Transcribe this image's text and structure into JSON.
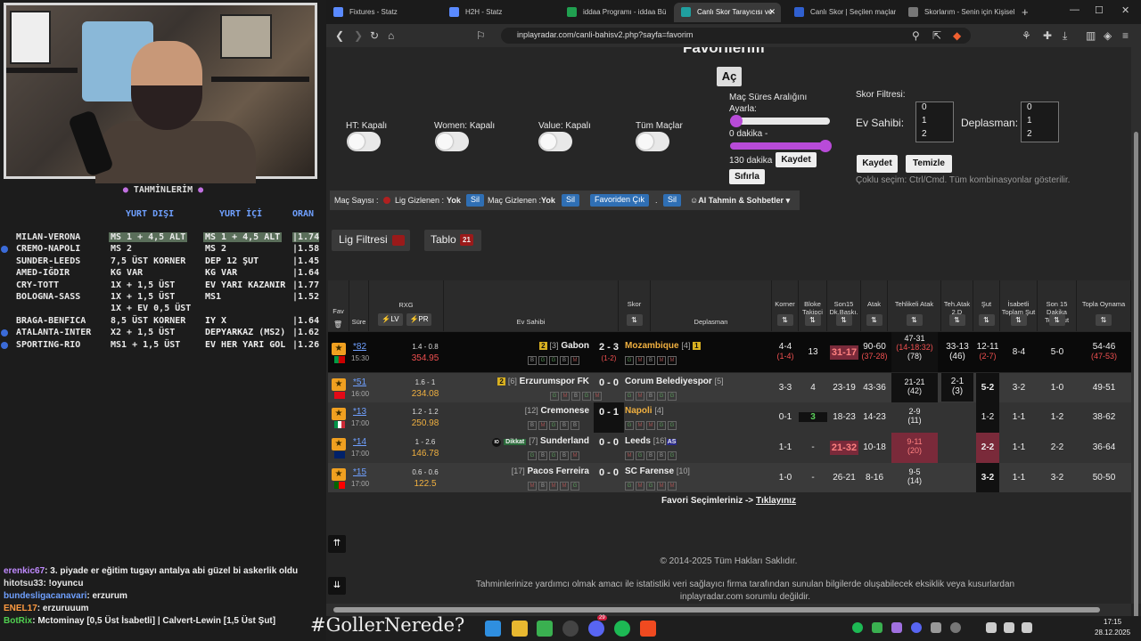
{
  "stream": {
    "title": "TAHMİNLERİM",
    "col_yurt_disi": "YURT DIŞI",
    "col_yurt_ici": "YURT İÇİ",
    "col_oran": "ORAN",
    "picks": [
      {
        "match": "MILAN-VERONA",
        "a": "MS 1 + 4,5 ALT",
        "b": "MS 1 + 4,5 ALT",
        "odd": "|1.74",
        "hl": true,
        "dot": false
      },
      {
        "match": "CREMO-NAPOLI",
        "a": "MS 2",
        "b": "MS 2",
        "odd": "|1.58",
        "hl": false,
        "dot": true
      },
      {
        "match": "SUNDER-LEEDS",
        "a": "7,5 ÜST KORNER",
        "b": "DEP 12 ŞUT",
        "odd": "|1.45",
        "hl": false,
        "dot": false
      },
      {
        "match": "AMED-IĞDIR",
        "a": "KG VAR",
        "b": "KG VAR",
        "odd": "|1.64",
        "hl": false,
        "dot": false
      },
      {
        "match": "CRY-TOTT",
        "a": "1X + 1,5 ÜST",
        "b": "EV YARI KAZANIR",
        "odd": "|1.77",
        "hl": false,
        "dot": false
      },
      {
        "match": "BOLOGNA-SASS",
        "a": "1X + 1,5 ÜST",
        "b": "MS1",
        "odd": "|1.52",
        "hl": false,
        "dot": false
      },
      {
        "match": "",
        "a": "1X + EV 0,5 ÜST",
        "b": "",
        "odd": "",
        "hl": false,
        "dot": false
      },
      {
        "match": "BRAGA-BENFICA",
        "a": "8,5 ÜST KORNER",
        "b": "IY X",
        "odd": "|1.64",
        "hl": false,
        "dot": false
      },
      {
        "match": "ATALANTA-INTER",
        "a": "X2 + 1,5 ÜST",
        "b": "DEPYARKAZ (MS2)",
        "odd": "|1.62",
        "hl": false,
        "dot": true
      },
      {
        "match": "SPORTING-RIO",
        "a": "MS1 + 1,5 ÜST",
        "b": "EV HER YARI GOL",
        "odd": "|1.26",
        "hl": false,
        "dot": true
      }
    ],
    "chat": [
      {
        "user": "erenkic67",
        "msg": ": 3. piyade er eğitim tugayı antalya abi güzel bi askerlik oldu",
        "color": "#c08aff"
      },
      {
        "user": "hitotsu33",
        "msg": ": !oyuncu",
        "color": "#ddd"
      },
      {
        "user": "bundesligacanavari",
        "msg": ": erzurum",
        "color": "#6fa0ff"
      },
      {
        "user": "ENEL17",
        "msg": ": erzuruuum",
        "color": "#ff9a40"
      },
      {
        "user": "BotRix",
        "msg": ": Mctominay [0,5 Üst İsabetli] | Calvert-Lewin [1,5 Üst Şut]",
        "color": "#50d050"
      }
    ]
  },
  "browser": {
    "tabs": [
      {
        "label": "Fixtures - Statz",
        "color": "#5a8aff",
        "active": false
      },
      {
        "label": "H2H - Statz",
        "color": "#5a8aff",
        "active": false
      },
      {
        "label": "iddaa Programı - iddaa Bü",
        "color": "#20a050",
        "active": false
      },
      {
        "label": "Canlı Skor Tarayıcısı ve",
        "color": "#20a0a0",
        "active": true
      },
      {
        "label": "Canlı Skor | Seçilen maçlar",
        "color": "#3060d0",
        "active": false
      },
      {
        "label": "Skorlarım - Senin için Kişisel",
        "color": "#777",
        "active": false
      }
    ],
    "url": "inplayradar.com/canli-bahisv2.php?sayfa=favorim"
  },
  "page": {
    "heading": "Favorilerim",
    "ac_button": "Aç",
    "ht": "HT: Kapalı",
    "women": "Women: Kapalı",
    "value": "Value: Kapalı",
    "tum": "Tüm Maçlar",
    "range_title": "Maç Süres Aralığını Ayarla:",
    "range_min": "0 dakika -",
    "range_max": "130 dakika",
    "kaydet": "Kaydet",
    "sifirla": "Sıfırla",
    "skor_filtresi": "Skor Filtresi:",
    "ev_sahibi": "Ev Sahibi:",
    "deplasman": "Deplasman:",
    "opts": [
      "0",
      "1",
      "2"
    ],
    "kaydet2": "Kaydet",
    "temizle": "Temizle",
    "coklu": "Çoklu seçim: Ctrl/Cmd. Tüm kombinasyonlar gösterilir.",
    "filterbar": {
      "mac_sayisi": "Maç Sayısı :",
      "lig_gizlenen": "Lig Gizlenen :",
      "yok1": "Yok",
      "sil1": "Sil",
      "mac_gizlenen": "Maç Gizlenen :",
      "yok2": "Yok",
      "sil2": "Sil",
      "favoriden": "Favoriden Çık",
      "dot": ".",
      "sil3": "Sil",
      "ai": "AI Tahmin & Sohbetler"
    },
    "lig_filtresi": "Lig Filtresi",
    "tablo": "Tablo",
    "tablo_count": "21",
    "footer_fav": "Favori Seçimleriniz ->",
    "footer_link": "Tıklayınız",
    "copyright": "© 2014-2025 Tüm Hakları Saklıdır.",
    "disclaimer": "Tahminlerinize yardımcı olmak amacı ile istatistiki veri sağlayıcı firma tarafından sunulan bilgilerde oluşabilecek eksiklik veya kusurlardan inplayradar.com sorumlu değildir."
  },
  "table": {
    "headers": {
      "fav": "Fav",
      "sure": "Süre",
      "rxg": "RXG",
      "lv": "LV",
      "pr": "PR",
      "ev": "Ev Sahibi",
      "skor": "Skor",
      "dep": "Deplasman",
      "korner": "Korner",
      "bloke": "Bloke Takipçi",
      "son15": "Son15 Dk.Baskı.",
      "atak": "Atak",
      "tehlikeli": "Tehlikeli Atak",
      "teh2d": "Teh.Atak 2.D",
      "sut": "Şut",
      "isabetli": "İsabetli Toplam Şut",
      "son15sut": "Son 15 Dakika Topl.Şut",
      "topla": "Topla Oynama"
    },
    "rows": [
      {
        "min": "*82",
        "kick": "15:30",
        "rxg": "1.4 - 0.8",
        "rval": "354.95",
        "home_badge": "2",
        "home_rank": "[3]",
        "home": "Gabon",
        "score": "2 - 3",
        "ht": "(1-2)",
        "away": "Mozambique",
        "away_rank": "[4]",
        "away_badge": "1",
        "hform": [
          "B",
          "G",
          "G",
          "B",
          "M"
        ],
        "aform": [
          "G",
          "M",
          "B",
          "M",
          "M"
        ],
        "korner": "4-4",
        "korner2": "(1-4)",
        "bloke": "13",
        "son15": "31-17",
        "atak": "90-60",
        "atak2": "(37-28)",
        "teh": "47-31",
        "teh2": "(14-18:32)",
        "teh3": "(78)",
        "teh2d": "33-13",
        "teh2d2": "(46)",
        "sut": "12-11",
        "sut2": "(2-7)",
        "isab": "8-4",
        "s15": "5-0",
        "topla": "54-46",
        "topla2": "(47-53)"
      },
      {
        "min": "*51",
        "kick": "16:00",
        "rxg": "1.6 - 1",
        "rval": "234.08",
        "home_badge": "2",
        "home_rank": "[6]",
        "home": "Erzurumspor FK",
        "score": "0 - 0",
        "ht": "",
        "away": "Corum Belediyespor",
        "away_rank": "[5]",
        "away_badge": "",
        "hform": [
          "G",
          "M",
          "B",
          "G",
          "M"
        ],
        "aform": [
          "G",
          "M",
          "B",
          "G",
          "G"
        ],
        "korner": "3-3",
        "korner2": "",
        "bloke": "4",
        "son15": "23-19",
        "atak": "43-36",
        "atak2": "",
        "teh": "21-21",
        "teh2": "(42)",
        "teh3": "",
        "teh2d": "2-1",
        "teh2d2": "(3)",
        "sut": "5-2",
        "sut2": "",
        "isab": "3-2",
        "s15": "1-0",
        "topla": "49-51",
        "topla2": ""
      },
      {
        "min": "*13",
        "kick": "17:00",
        "rxg": "1.2 - 1.2",
        "rval": "250.98",
        "home_badge": "",
        "home_rank": "[12]",
        "home": "Cremonese",
        "score": "0 - 1",
        "ht": "",
        "away": "Napoli",
        "away_rank": "[4]",
        "away_badge": "",
        "hform": [
          "B",
          "M",
          "G",
          "B",
          "B"
        ],
        "aform": [
          "G",
          "M",
          "M",
          "G",
          "G"
        ],
        "korner": "0-1",
        "korner2": "",
        "bloke": "3",
        "son15": "18-23",
        "atak": "14-23",
        "atak2": "",
        "teh": "2-9",
        "teh2": "(11)",
        "teh3": "",
        "teh2d": "",
        "teh2d2": "",
        "sut": "1-2",
        "sut2": "",
        "isab": "1-1",
        "s15": "1-2",
        "topla": "38-62",
        "topla2": ""
      },
      {
        "min": "*14",
        "kick": "17:00",
        "rxg": "1 - 2.6",
        "rval": "146.78",
        "home_badge": "Dikkat",
        "home_rank": "[7]",
        "home": "Sunderland",
        "score": "0 - 0",
        "ht": "",
        "away": "Leeds",
        "away_rank": "[16]",
        "away_badge": "AS",
        "hform": [
          "G",
          "B",
          "G",
          "B",
          "M"
        ],
        "aform": [
          "M",
          "G",
          "B",
          "B",
          "G"
        ],
        "korner": "1-1",
        "korner2": "",
        "bloke": "-",
        "son15": "21-32",
        "atak": "10-18",
        "atak2": "",
        "teh": "9-11",
        "teh2": "(20)",
        "teh3": "",
        "teh2d": "",
        "teh2d2": "",
        "sut": "2-2",
        "sut2": "",
        "isab": "1-1",
        "s15": "2-2",
        "topla": "36-64",
        "topla2": ""
      },
      {
        "min": "*15",
        "kick": "17:00",
        "rxg": "0.6 - 0.6",
        "rval": "122.5",
        "home_badge": "",
        "home_rank": "[17]",
        "home": "Pacos Ferreira",
        "score": "0 - 0",
        "ht": "",
        "away": "SC Farense",
        "away_rank": "[10]",
        "away_badge": "",
        "hform": [
          "M",
          "B",
          "M",
          "M",
          "G"
        ],
        "aform": [
          "G",
          "M",
          "G",
          "M",
          "M"
        ],
        "korner": "1-0",
        "korner2": "",
        "bloke": "-",
        "son15": "26-21",
        "atak": "8-16",
        "atak2": "",
        "teh": "9-5",
        "teh2": "(14)",
        "teh3": "",
        "teh2d": "",
        "teh2d2": "",
        "sut": "3-2",
        "sut2": "",
        "isab": "1-1",
        "s15": "3-2",
        "topla": "50-50",
        "topla2": ""
      }
    ]
  },
  "taskbar": {
    "hashtag": "#GollerNerede?",
    "time": "17:15",
    "date": "28.12.2025",
    "badge": "29"
  }
}
